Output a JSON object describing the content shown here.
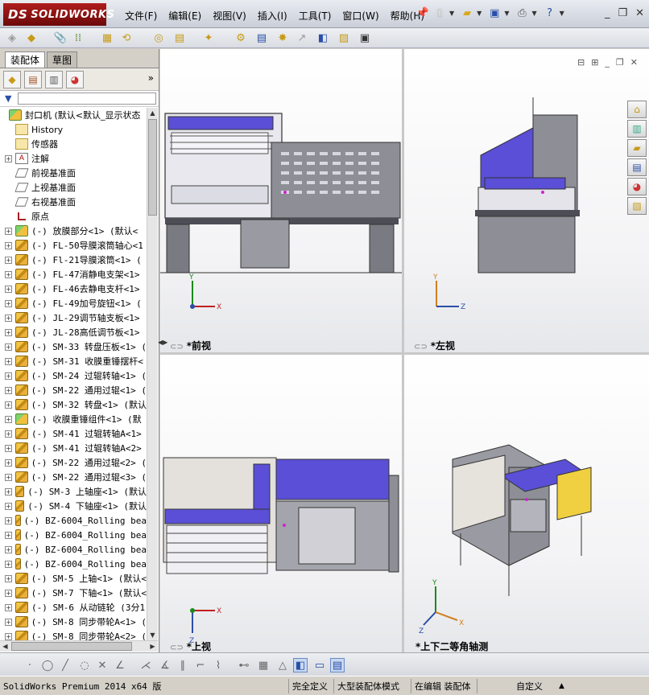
{
  "app": {
    "logo_text": "SOLIDWORKS",
    "logo_ds": "DS"
  },
  "menu": [
    "文件(F)",
    "编辑(E)",
    "视图(V)",
    "插入(I)",
    "工具(T)",
    "窗口(W)",
    "帮助(H)"
  ],
  "left_tabs": {
    "assembly": "装配体",
    "drawing": "草图"
  },
  "tree": {
    "root": "封口机  (默认<默认_显示状态",
    "items": [
      {
        "label": "History",
        "icon": "history-icon",
        "expand": false
      },
      {
        "label": "传感器",
        "icon": "sensor-icon",
        "expand": false
      },
      {
        "label": "注解",
        "icon": "annotation-icon",
        "expand": true
      },
      {
        "label": "前视基准面",
        "icon": "plane-icon",
        "expand": false
      },
      {
        "label": "上视基准面",
        "icon": "plane-icon",
        "expand": false
      },
      {
        "label": "右视基准面",
        "icon": "plane-icon",
        "expand": false
      },
      {
        "label": "原点",
        "icon": "origin-icon",
        "expand": false
      },
      {
        "label": "(-) 放膜部分<1> (默认<",
        "icon": "assembly-icon",
        "expand": true
      },
      {
        "label": "(-) FL-50导膜滚筒轴心<1",
        "icon": "part-icon",
        "expand": true
      },
      {
        "label": "(-) Fl-21导膜滚筒<1> (",
        "icon": "part-icon",
        "expand": true
      },
      {
        "label": "(-) FL-47消静电支架<1>",
        "icon": "part-icon",
        "expand": true
      },
      {
        "label": "(-) FL-46去静电支杆<1>",
        "icon": "part-icon",
        "expand": true
      },
      {
        "label": "(-) FL-49加号旋钮<1> (",
        "icon": "part-icon",
        "expand": true
      },
      {
        "label": "(-) JL-29调节轴支板<1>",
        "icon": "part-icon",
        "expand": true
      },
      {
        "label": "(-) JL-28高低调节板<1>",
        "icon": "part-icon",
        "expand": true
      },
      {
        "label": "(-) SM-33 转盘压板<1> (",
        "icon": "part-icon",
        "expand": true
      },
      {
        "label": "(-) SM-31 收膜重锤摆杆<",
        "icon": "part-icon",
        "expand": true
      },
      {
        "label": "(-) SM-24 过辊转轴<1> (",
        "icon": "part-icon",
        "expand": true
      },
      {
        "label": "(-) SM-22 通用过辊<1> (",
        "icon": "part-icon",
        "expand": true
      },
      {
        "label": "(-) SM-32 转盘<1> (默认",
        "icon": "part-icon",
        "expand": true
      },
      {
        "label": "(-) 收膜重锤组件<1> (默",
        "icon": "assembly-icon",
        "expand": true
      },
      {
        "label": "(-) SM-41 过辊转轴A<1>",
        "icon": "part-icon",
        "expand": true
      },
      {
        "label": "(-) SM-41 过辊转轴A<2>",
        "icon": "part-icon",
        "expand": true
      },
      {
        "label": "(-) SM-22 通用过辊<2> (",
        "icon": "part-icon",
        "expand": true
      },
      {
        "label": "(-) SM-22 通用过辊<3> (",
        "icon": "part-icon",
        "expand": true
      },
      {
        "label": "(-) SM-3 上轴座<1> (默认",
        "icon": "part-icon",
        "expand": true
      },
      {
        "label": "(-) SM-4 下轴座<1> (默认",
        "icon": "part-icon",
        "expand": true
      },
      {
        "label": "(-) BZ-6004_Rolling bea",
        "icon": "part-icon",
        "expand": true
      },
      {
        "label": "(-) BZ-6004_Rolling bea",
        "icon": "part-icon",
        "expand": true
      },
      {
        "label": "(-) BZ-6004_Rolling bea",
        "icon": "part-icon",
        "expand": true
      },
      {
        "label": "(-) BZ-6004_Rolling bea",
        "icon": "part-icon",
        "expand": true
      },
      {
        "label": "(-) SM-5 上轴<1> (默认<",
        "icon": "part-icon",
        "expand": true
      },
      {
        "label": "(-) SM-7 下轴<1> (默认<",
        "icon": "part-icon",
        "expand": true
      },
      {
        "label": "(-) SM-6 从动链轮 (3分1",
        "icon": "part-icon",
        "expand": true
      },
      {
        "label": "(-) SM-8 同步带轮A<1> (",
        "icon": "part-icon",
        "expand": true
      },
      {
        "label": "(-) SM-8 同步带轮A<2> (",
        "icon": "part-icon",
        "expand": true
      }
    ]
  },
  "viewports": {
    "front": "*前视",
    "left": "*左视",
    "top": "*上视",
    "iso": "*上下二等角轴测"
  },
  "triad": {
    "x": "X",
    "y": "Y",
    "z": "Z"
  },
  "status": {
    "app_version": "SolidWorks Premium 2014 x64 版",
    "state": "完全定义",
    "mode": "大型装配体模式",
    "editing": "在编辑 装配体",
    "units": "自定义"
  },
  "colors": {
    "machine_gray": "#8e8e96",
    "panel_blue": "#5a4fd6",
    "frame_dark": "#4d4d55"
  }
}
